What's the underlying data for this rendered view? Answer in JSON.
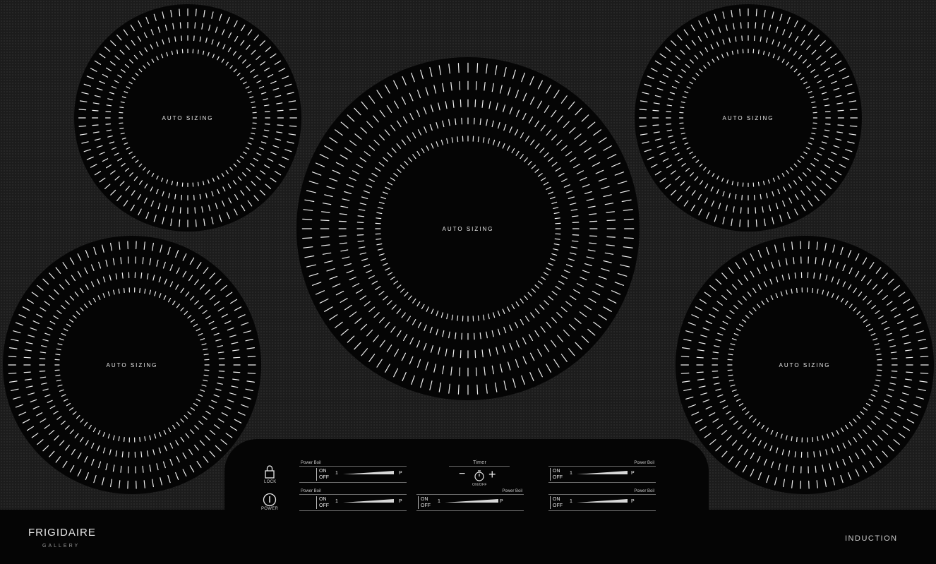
{
  "burners": [
    {
      "id": "rear-left",
      "label": "AUTO SIZING"
    },
    {
      "id": "center",
      "label": "AUTO SIZING"
    },
    {
      "id": "rear-right",
      "label": "AUTO SIZING"
    },
    {
      "id": "front-left",
      "label": "AUTO SIZING"
    },
    {
      "id": "front-right",
      "label": "AUTO SIZING"
    }
  ],
  "controls": {
    "lock_label": "LOCK",
    "power_label": "POWER",
    "timer": {
      "label": "Timer",
      "minus": "−",
      "plus": "+",
      "onoff": "ON/OFF"
    },
    "zones": [
      {
        "id": "rear-left",
        "power_boil": "Power Boil",
        "on": "ON",
        "off": "OFF",
        "min": "1",
        "max": "P"
      },
      {
        "id": "front-left",
        "power_boil": "Power Boil",
        "on": "ON",
        "off": "OFF",
        "min": "1",
        "max": "P"
      },
      {
        "id": "center",
        "power_boil": "Power Boil",
        "on": "ON",
        "off": "OFF",
        "min": "1",
        "max": "P"
      },
      {
        "id": "rear-right",
        "power_boil": "Power Boil",
        "on": "ON",
        "off": "OFF",
        "min": "1",
        "max": "P"
      },
      {
        "id": "front-right",
        "power_boil": "Power Boil",
        "on": "ON",
        "off": "OFF",
        "min": "1",
        "max": "P"
      }
    ]
  },
  "brand": {
    "name": "FRIGIDAIRE",
    "sub": "GALLERY",
    "type": "INDUCTION"
  },
  "colors": {
    "surface": "#1c1c1c",
    "burner": "#050505",
    "markings": "#f0f0f0"
  }
}
